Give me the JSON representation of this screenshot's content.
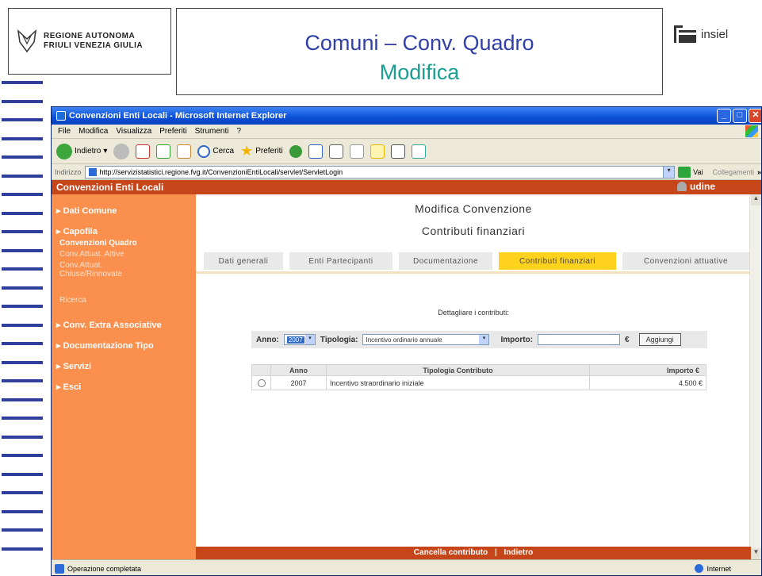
{
  "slide": {
    "logo_left_line1": "REGIONE AUTONOMA",
    "logo_left_line2": "FRIULI VENEZIA GIULIA",
    "title_line1": "Comuni – Conv. Quadro",
    "title_line2": "Modifica",
    "logo_right": "insiel"
  },
  "browser": {
    "window_title": "Convenzioni Enti Locali - Microsoft Internet Explorer",
    "menu": [
      "File",
      "Modifica",
      "Visualizza",
      "Preferiti",
      "Strumenti",
      "?"
    ],
    "toolbar": {
      "back": "Indietro",
      "search": "Cerca",
      "favorites": "Preferiti"
    },
    "address_label": "Indirizzo",
    "address_url": "http://servizistatistici.regione.fvg.it/ConvenzioniEntiLocali/servlet/ServletLogin",
    "go_label": "Vai",
    "links_label": "Collegamenti",
    "status_text": "Operazione completata",
    "zone_text": "Internet"
  },
  "app": {
    "header_title": "Convenzioni Enti Locali",
    "user": "udine",
    "sidebar": {
      "dati_comune": "Dati Comune",
      "capofila": "Capofila",
      "conv_quadro": "Convenzioni Quadro",
      "conv_attive": "Conv.Attuat. Attive",
      "conv_chiuse_1": "Conv.Attuat.",
      "conv_chiuse_2": "Chiuse/Rinnovate",
      "ricerca": "Ricerca",
      "extra": "Conv. Extra Associative",
      "documentazione": "Documentazione Tipo",
      "servizi": "Servizi",
      "esci": "Esci"
    },
    "page_title": "Modifica Convenzione",
    "page_subtitle": "Contributi finanziari",
    "tabs": [
      "Dati generali",
      "Enti Partecipanti",
      "Documentazione",
      "Contributi finanziari",
      "Convenzioni attuative"
    ],
    "active_tab": "Contributi finanziari",
    "prompt": "Dettagliare i contributi:",
    "form": {
      "anno_label": "Anno:",
      "anno_value": "2007",
      "tipologia_label": "Tipologia:",
      "tipologia_value": "Incentivo ordinario annuale",
      "importo_label": "Importo:",
      "currency": "€",
      "add_button": "Aggiungi"
    },
    "table": {
      "headers": [
        "",
        "Anno",
        "Tipologia Contributo",
        "Importo €"
      ],
      "rows": [
        {
          "anno": "2007",
          "tipologia": "Incentivo straordinario iniziale",
          "importo": "4.500 €"
        }
      ]
    },
    "footer": {
      "cancel": "Cancella contributo",
      "separator": "|",
      "back": "Indietro"
    }
  }
}
